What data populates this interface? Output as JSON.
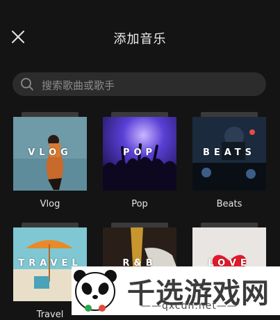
{
  "header": {
    "title": "添加音乐",
    "close_icon": "close-icon"
  },
  "search": {
    "placeholder": "搜索歌曲或歌手",
    "icon": "search-icon"
  },
  "categories": [
    {
      "id": "vlog",
      "overlay": "VLOG",
      "label": "Vlog"
    },
    {
      "id": "pop",
      "overlay": "POP",
      "label": "Pop"
    },
    {
      "id": "beats",
      "overlay": "BEATS",
      "label": "Beats"
    },
    {
      "id": "travel",
      "overlay": "TRAVEL",
      "label": "Travel"
    },
    {
      "id": "rnb",
      "overlay": "R&B",
      "label": ""
    },
    {
      "id": "love",
      "overlay": "LOVE",
      "label": ""
    }
  ],
  "watermark": {
    "brand": "千选游戏网",
    "url": "——qxcdn.net——"
  },
  "colors": {
    "background": "#141414",
    "search_bg": "#2c2c2c",
    "text": "#e8e8e8"
  }
}
